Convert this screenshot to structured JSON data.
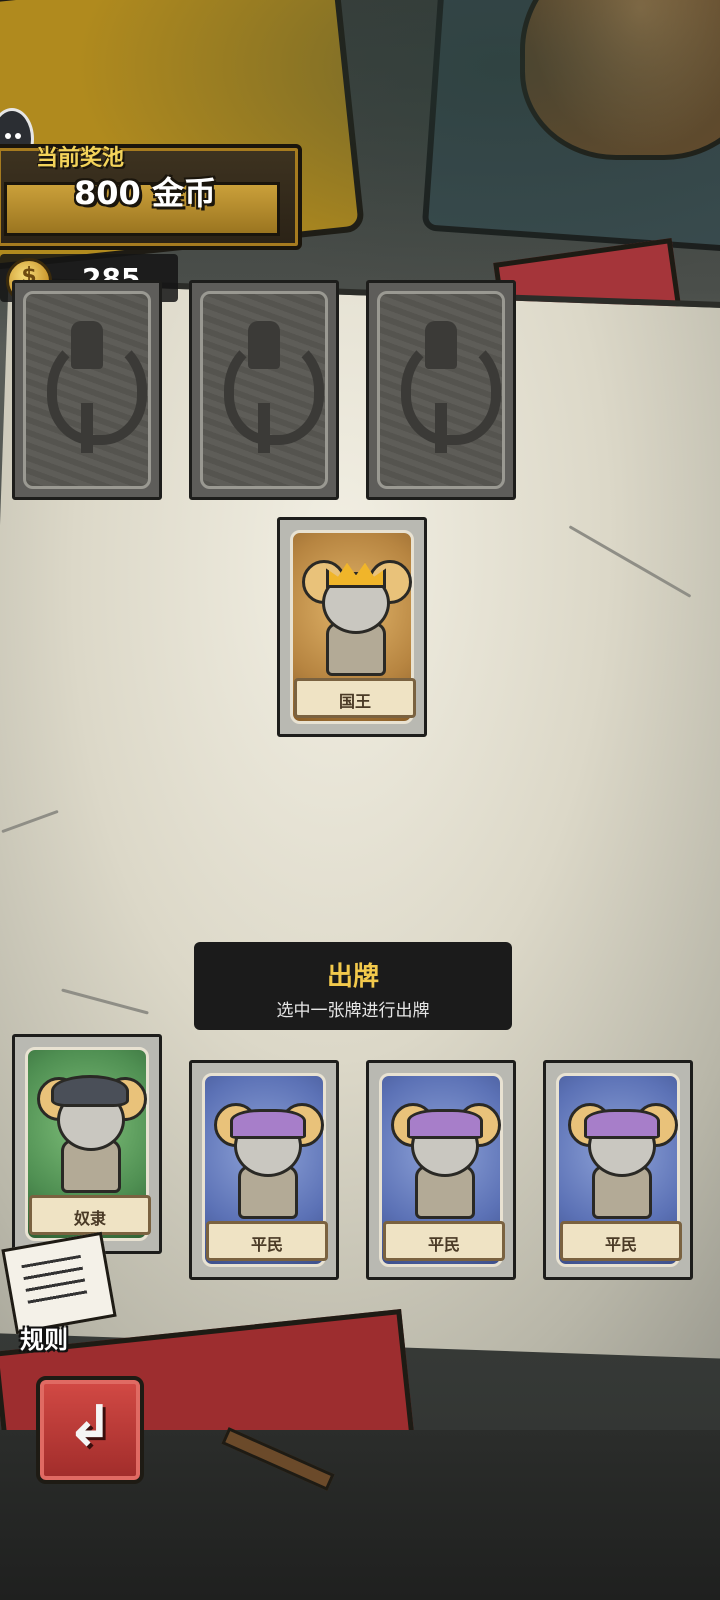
{
  "prize_pool": {
    "title": "当前奖池",
    "amount": "800 金币"
  },
  "player_coins": {
    "count": "285",
    "icon": "coin-icon"
  },
  "opponent_cards": [
    {
      "face": "hidden"
    },
    {
      "face": "hidden"
    },
    {
      "face": "hidden"
    }
  ],
  "played_card": {
    "label": "国王"
  },
  "play_prompt": {
    "title": "出牌",
    "subtitle": "选中一张牌进行出牌"
  },
  "hand": [
    {
      "label": "奴隶",
      "color": "#4f8f52"
    },
    {
      "label": "平民",
      "color": "#5c72b6"
    },
    {
      "label": "平民",
      "color": "#5c72b6"
    },
    {
      "label": "平民",
      "color": "#5c72b6"
    }
  ],
  "rules_button": {
    "label": "规则"
  },
  "back_button": {
    "icon": "back-arrow-icon"
  },
  "colors": {
    "gold": "#f3d35a",
    "prompt_title": "#f2c94c",
    "king_card": "#b78541"
  }
}
